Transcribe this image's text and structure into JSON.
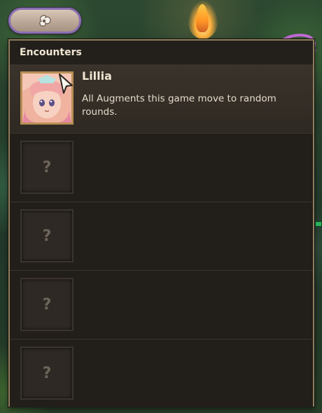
{
  "top_button": {
    "icon": "swirl-icon"
  },
  "panel": {
    "title": "Encounters",
    "encounters": [
      {
        "name": "Lillia",
        "description": "All Augments this game move to random rounds.",
        "revealed": true
      },
      {
        "placeholder": "?",
        "revealed": false
      },
      {
        "placeholder": "?",
        "revealed": false
      },
      {
        "placeholder": "?",
        "revealed": false
      },
      {
        "placeholder": "?",
        "revealed": false
      }
    ]
  },
  "colors": {
    "panel_bg": "#1e1a17",
    "panel_border": "#8f7f5e",
    "title_text": "#f0e6d2",
    "pill_border": "#8a6fb1",
    "portrait_frame": "#b98f55"
  }
}
